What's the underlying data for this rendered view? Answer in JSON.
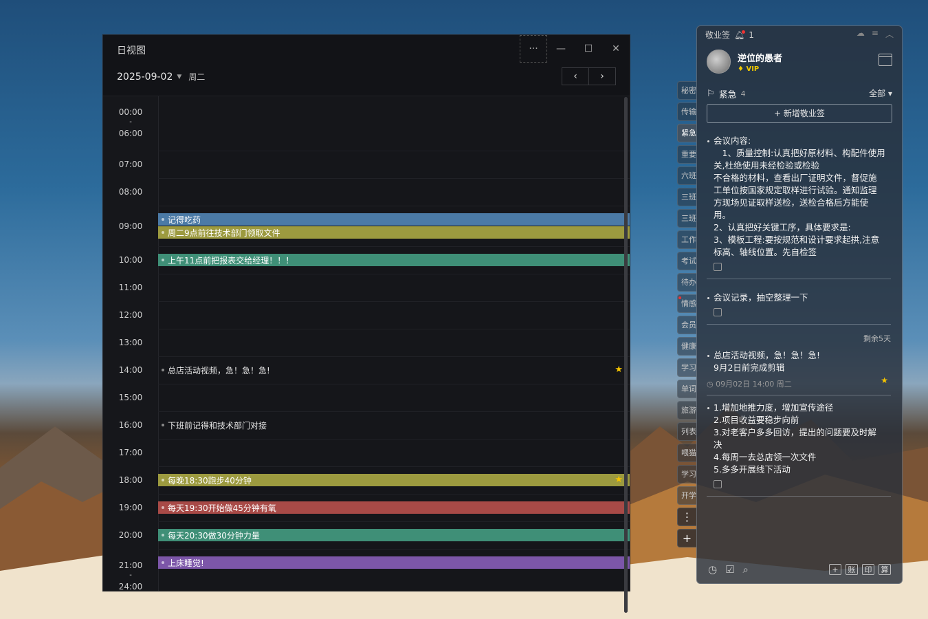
{
  "dayview": {
    "title": "日视图",
    "date": "2025-09-02",
    "weekday": "周二",
    "more_label": "···",
    "min_label": "—",
    "max_label": "☐",
    "close_label": "✕",
    "prev_label": "‹",
    "next_label": "›",
    "times": [
      "00:00",
      "-",
      "06:00",
      "07:00",
      "08:00",
      "09:00",
      "10:00",
      "11:00",
      "12:00",
      "13:00",
      "14:00",
      "15:00",
      "16:00",
      "17:00",
      "18:00",
      "19:00",
      "20:00",
      "21:00",
      "-",
      "24:00"
    ],
    "events": [
      {
        "text": "记得吃药",
        "color": "#4b7aa6"
      },
      {
        "text": "周二9点前往技术部门领取文件",
        "color": "#9c9a3f"
      },
      {
        "text": "上午11点前把报表交给经理！！！",
        "color": "#3f8f77"
      },
      {
        "text": "总店活动视频，急！急！急!",
        "color": ""
      },
      {
        "text": "下班前记得和技术部门对接",
        "color": ""
      },
      {
        "text": "每晚18:30跑步40分钟",
        "color": "#9c9a3f"
      },
      {
        "text": "每天19:30开始做45分钟有氧",
        "color": "#a84a47"
      },
      {
        "text": "每天20:30做30分钟力量",
        "color": "#3f8f77"
      },
      {
        "text": "上床睡觉!",
        "color": "#7c56a8"
      }
    ]
  },
  "sidetabs": [
    "秘密",
    "传输",
    "紧急",
    "重要",
    "六班",
    "三班",
    "三班",
    "工作",
    "考试",
    "待办",
    "情感",
    "会员",
    "健康",
    "学习",
    "单词",
    "旅游",
    "列表",
    "喂猫",
    "学习",
    "开学"
  ],
  "sidetab_more": "⋮",
  "sidetab_add": "+",
  "panel": {
    "app_name": "敬业签",
    "notif_count": "1",
    "username": "逆位的愚者",
    "vip": "VIP",
    "category": "紧急",
    "category_count": "4",
    "filter": "全部",
    "add_label": "+ 新增敬业签",
    "notes": [
      {
        "lines": [
          "会议内容:",
          "　1、质量控制:认真把好原材料、构配件使用",
          "关,杜绝使用未经检验或检验",
          "不合格的材料，查看出厂证明文件，督促施",
          "工单位按国家规定取样进行试验。通知监理",
          "方现场见证取样送检，送检合格后方能使",
          "用。",
          "2、认真把好关键工序，具体要求是:",
          "3、模板工程:要按规范和设计要求起拱,注意",
          "标高、轴线位置。先自检签"
        ]
      },
      {
        "lines": [
          "会议记录，抽空整理一下"
        ]
      },
      {
        "remain": "剩余5天",
        "lines": [
          "总店活动视频，急！急！急!",
          "9月2日前完成剪辑"
        ],
        "meta": "09月02日 14:00 周二"
      },
      {
        "lines": [
          "1.增加地推力度，增加宣传途径",
          "2.项目收益要稳步向前",
          "3.对老客户多多回访，提出的问题要及时解",
          "决",
          "4.每周一去总店领一次文件",
          "5.多多开展线下活动"
        ]
      }
    ],
    "footer_right": [
      "+",
      "账",
      "印",
      "算"
    ]
  }
}
